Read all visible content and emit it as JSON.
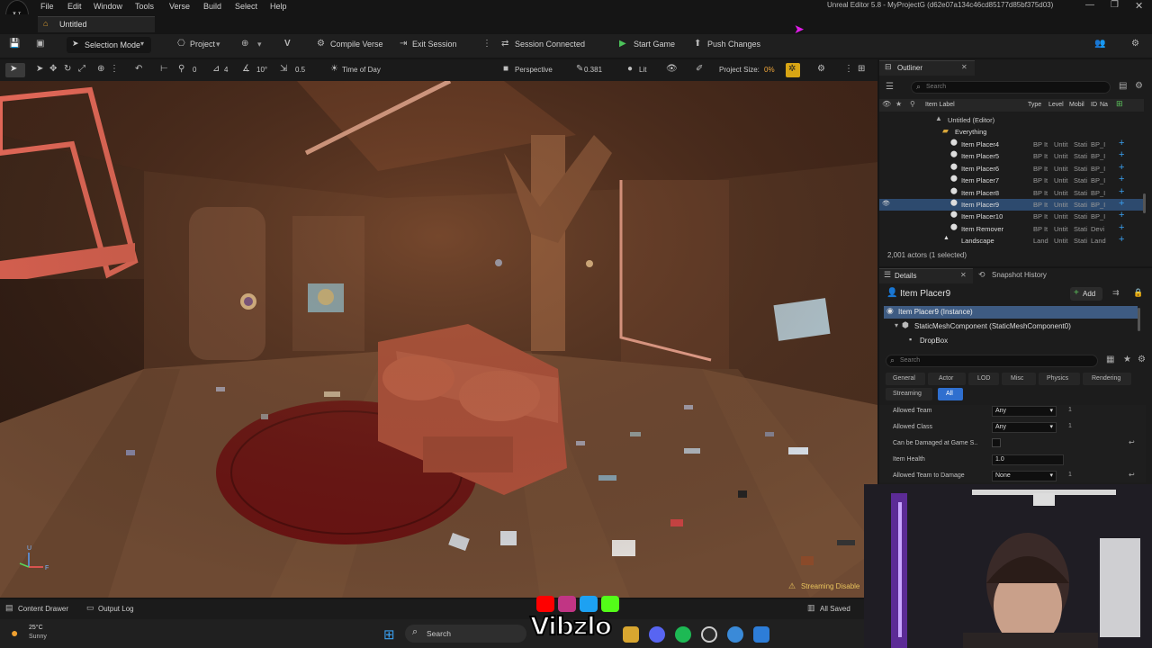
{
  "app": {
    "title": "Unreal Editor 5.8 - MyProjectG (d62e07a134c46cd85177d85bf375d03)",
    "menus": [
      "File",
      "Edit",
      "Window",
      "Tools",
      "Verse",
      "Build",
      "Select",
      "Help"
    ],
    "doc_tab": "Untitled"
  },
  "toolbar": {
    "selection_mode": "Selection Mode",
    "project": "Project",
    "compile_verse": "Compile Verse",
    "exit_session": "Exit Session",
    "session_status": "Session Connected",
    "start_game": "Start Game",
    "push_changes": "Push Changes"
  },
  "viewport_toolbar": {
    "snap_values": [
      "0",
      "4",
      "10°",
      "0.5"
    ],
    "time_of_day": "Time of Day",
    "perspective": "Perspective",
    "camera_speed": "0.381",
    "view_mode": "Lit",
    "project_size_label": "Project Size:",
    "project_size_value": "0%"
  },
  "viewport": {
    "streaming_warning": "Streaming Disable",
    "axis_labels": [
      "U",
      "F"
    ]
  },
  "outliner": {
    "tab": "Outliner",
    "search_placeholder": "Search",
    "columns": [
      "Item Label",
      "Type",
      "Level",
      "Mobil",
      "ID",
      "Na"
    ],
    "root": "Untitled (Editor)",
    "folder": "Everything",
    "rows": [
      {
        "label": "Item Placer4",
        "type": "BP It",
        "level": "Untit",
        "mobility": "Stati",
        "id": "BP_I"
      },
      {
        "label": "Item Placer5",
        "type": "BP It",
        "level": "Untit",
        "mobility": "Stati",
        "id": "BP_I"
      },
      {
        "label": "Item Placer6",
        "type": "BP It",
        "level": "Untit",
        "mobility": "Stati",
        "id": "BP_I"
      },
      {
        "label": "Item Placer7",
        "type": "BP It",
        "level": "Untit",
        "mobility": "Stati",
        "id": "BP_I"
      },
      {
        "label": "Item Placer8",
        "type": "BP It",
        "level": "Untit",
        "mobility": "Stati",
        "id": "BP_I"
      },
      {
        "label": "Item Placer9",
        "type": "BP It",
        "level": "Untit",
        "mobility": "Stati",
        "id": "BP_I"
      },
      {
        "label": "Item Placer10",
        "type": "BP It",
        "level": "Untit",
        "mobility": "Stati",
        "id": "BP_I"
      },
      {
        "label": "Item Remover",
        "type": "BP It",
        "level": "Untit",
        "mobility": "Stati",
        "id": "Devi"
      },
      {
        "label": "Landscape",
        "type": "Land",
        "level": "Untit",
        "mobility": "Stati",
        "id": "Land"
      }
    ],
    "status": "2,001 actors (1 selected)"
  },
  "details": {
    "tab": "Details",
    "tab2": "Snapshot History",
    "actor_name": "Item Placer9",
    "add_label": "Add",
    "tree": [
      "Item Placer9 (Instance)",
      "StaticMeshComponent (StaticMeshComponent0)",
      "DropBox"
    ],
    "search_placeholder": "Search",
    "categories": [
      "General",
      "Actor",
      "LOD",
      "Misc",
      "Physics",
      "Rendering",
      "Streaming",
      "All"
    ],
    "properties": [
      {
        "label": "Allowed Team",
        "value": "Any",
        "extra": "1"
      },
      {
        "label": "Allowed Class",
        "value": "Any",
        "extra": "1"
      },
      {
        "label": "Can be Damaged at Game S..",
        "value": "",
        "extra": ""
      },
      {
        "label": "Item Health",
        "value": "1.0",
        "extra": ""
      },
      {
        "label": "Allowed Team to Damage",
        "value": "None",
        "extra": "1"
      }
    ]
  },
  "statusbar": {
    "content_drawer": "Content Drawer",
    "output_log": "Output Log",
    "all_saved": "All Saved"
  },
  "taskbar": {
    "temperature": "25°C",
    "weather": "Sunny",
    "search": "Search"
  },
  "overlay": {
    "brand": "Vibzlo"
  }
}
